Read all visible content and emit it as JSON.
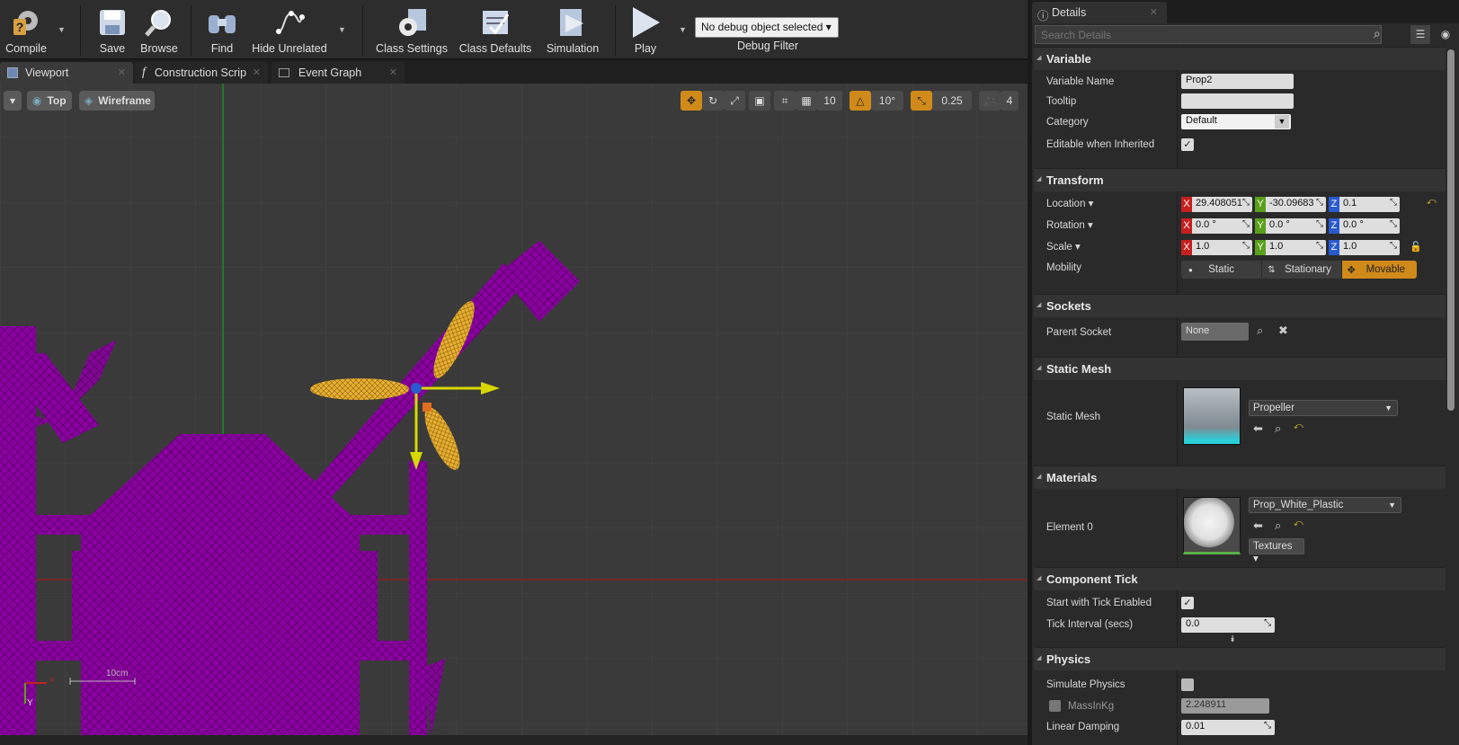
{
  "toolbar": {
    "compile": "Compile",
    "save": "Save",
    "browse": "Browse",
    "find": "Find",
    "hide_unrelated": "Hide Unrelated",
    "class_settings": "Class Settings",
    "class_defaults": "Class Defaults",
    "simulation": "Simulation",
    "play": "Play",
    "debug_selected": "No debug object selected",
    "debug_filter": "Debug Filter"
  },
  "tabs": [
    {
      "label": "Viewport"
    },
    {
      "label": "Construction Scrip"
    },
    {
      "label": "Event Graph"
    }
  ],
  "viewport": {
    "view_mode": "Top",
    "render_mode": "Wireframe",
    "grid_snap": "10",
    "rotation_snap": "10°",
    "scale_snap": "0.25",
    "camera_speed": "4",
    "scale_label": "10cm",
    "axis_x": "x",
    "axis_y": "Y"
  },
  "details": {
    "tab_title": "Details",
    "search_placeholder": "Search Details",
    "sections": {
      "variable": "Variable",
      "transform": "Transform",
      "sockets": "Sockets",
      "static_mesh": "Static Mesh",
      "materials": "Materials",
      "component_tick": "Component Tick",
      "physics": "Physics"
    },
    "variable": {
      "name_label": "Variable Name",
      "name_value": "Prop2",
      "tooltip_label": "Tooltip",
      "tooltip_value": "",
      "category_label": "Category",
      "category_value": "Default",
      "editable_label": "Editable when Inherited"
    },
    "transform": {
      "location_label": "Location",
      "rotation_label": "Rotation",
      "scale_label": "Scale",
      "mobility_label": "Mobility",
      "location": {
        "x": "29.408051",
        "y": "-30.09683",
        "z": "0.1"
      },
      "rotation": {
        "x": "0.0 °",
        "y": "0.0 °",
        "z": "0.0 °"
      },
      "scale": {
        "x": "1.0",
        "y": "1.0",
        "z": "1.0"
      },
      "mobility_static": "Static",
      "mobility_stationary": "Stationary",
      "mobility_movable": "Movable"
    },
    "sockets": {
      "parent_label": "Parent Socket",
      "parent_value": "None"
    },
    "static_mesh": {
      "label": "Static Mesh",
      "value": "Propeller"
    },
    "materials": {
      "label": "Element 0",
      "value": "Prop_White_Plastic",
      "textures": "Textures"
    },
    "component_tick": {
      "start_label": "Start with Tick Enabled",
      "interval_label": "Tick Interval (secs)",
      "interval_value": "0.0"
    },
    "physics": {
      "simulate_label": "Simulate Physics",
      "mass_label": "MassInKg",
      "mass_value": "2.248911",
      "damping_label": "Linear Damping",
      "damping_value": "0.01"
    }
  },
  "colors": {
    "accent_orange": "#d08a1a",
    "mesh_purple": "#8a00a0",
    "selected_yellow": "#e8b030",
    "axis_x": "#c42020",
    "axis_y": "#5aa01a",
    "axis_z": "#2a5ad0"
  }
}
